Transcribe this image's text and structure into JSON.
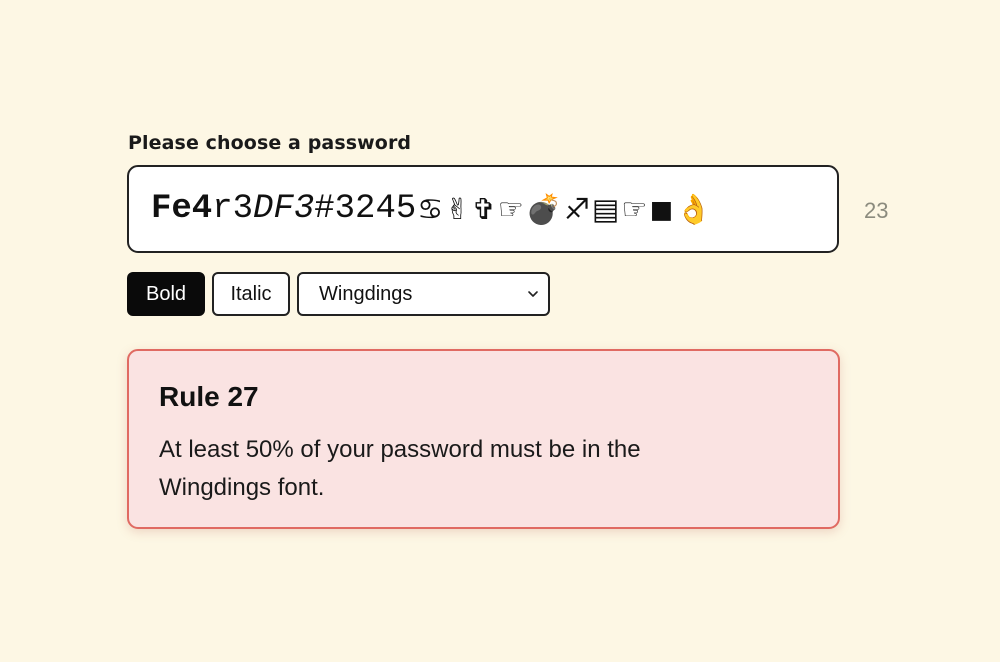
{
  "prompt": {
    "label": "Please choose a password"
  },
  "password": {
    "segments": [
      {
        "text": "Fe4",
        "style": "bold"
      },
      {
        "text": "r3",
        "style": "normal"
      },
      {
        "text": "DF3",
        "style": "italic"
      },
      {
        "text": "#3245",
        "style": "normal"
      }
    ],
    "wingdings_glyphs": [
      "♋",
      "✌",
      "✞",
      "☞",
      "💣",
      "♐",
      "▤",
      "☞",
      "◼",
      "👌"
    ],
    "char_count": "23"
  },
  "toolbar": {
    "bold_label": "Bold",
    "italic_label": "Italic",
    "font_selected": "Wingdings",
    "bold_active": true
  },
  "rule": {
    "title": "Rule 27",
    "text": "At least 50% of your password must be in the Wingdings font."
  },
  "colors": {
    "background": "#fdf7e4",
    "rule_bg": "#fae3e2",
    "rule_border": "#e06a62",
    "count": "#8b8b7e"
  }
}
